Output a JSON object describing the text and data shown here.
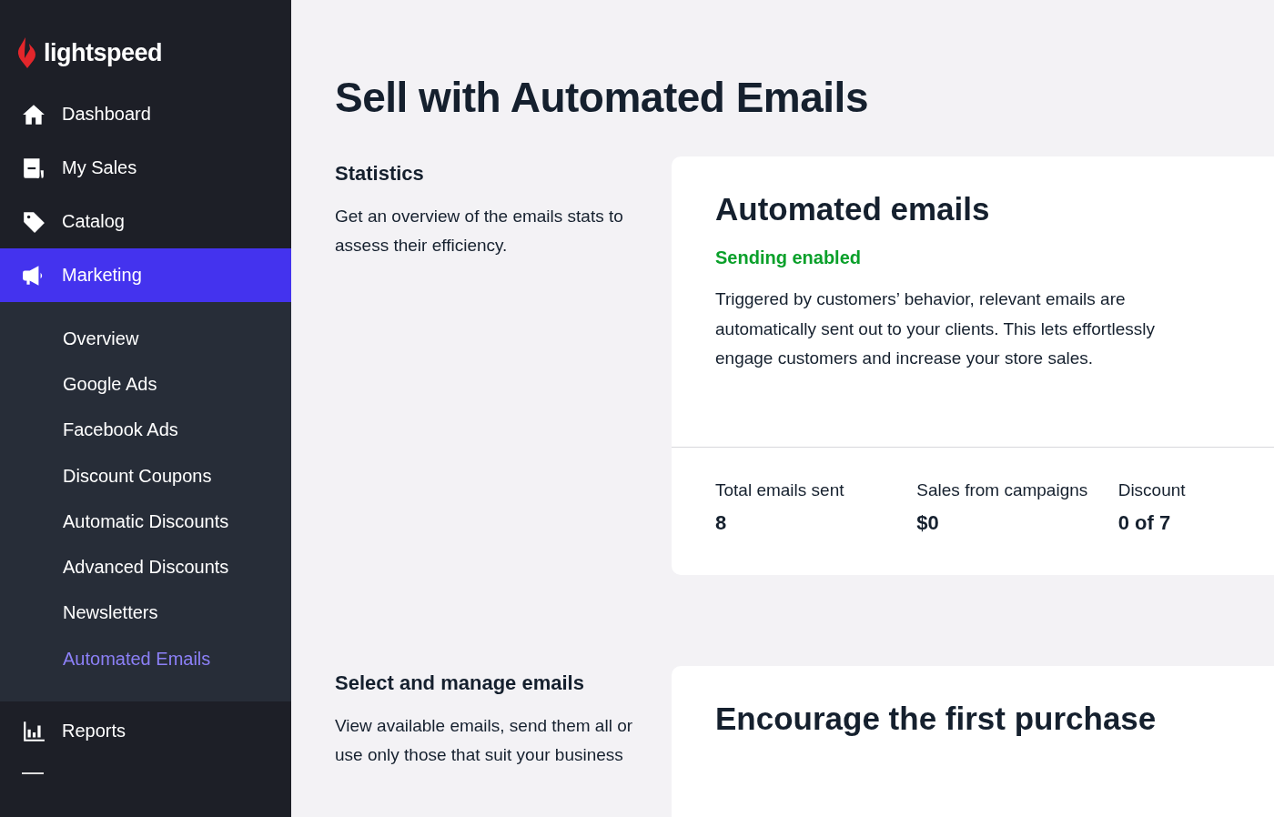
{
  "sidebar": {
    "logo": "lightspeed",
    "items": [
      {
        "label": "Dashboard",
        "selected": false
      },
      {
        "label": "My Sales",
        "selected": false
      },
      {
        "label": "Catalog",
        "selected": false
      },
      {
        "label": "Marketing",
        "selected": true,
        "children": [
          {
            "label": "Overview",
            "selected": false
          },
          {
            "label": "Google Ads",
            "selected": false
          },
          {
            "label": "Facebook Ads",
            "selected": false
          },
          {
            "label": "Discount Coupons",
            "selected": false
          },
          {
            "label": "Automatic Discounts",
            "selected": false
          },
          {
            "label": "Advanced Discounts",
            "selected": false
          },
          {
            "label": "Newsletters",
            "selected": false
          },
          {
            "label": "Automated Emails",
            "selected": true
          }
        ]
      },
      {
        "label": "Reports",
        "selected": false
      }
    ]
  },
  "page": {
    "title": "Sell with Automated Emails",
    "sections": [
      {
        "heading": "Statistics",
        "description": "Get an overview of the emails stats to assess their efficiency.",
        "card": {
          "title": "Automated emails",
          "status": "Sending enabled",
          "body": "Triggered by customers’ behavior, relevant emails are automatically sent out to your clients. This lets effortlessly engage customers and increase your store sales.",
          "stats": [
            {
              "label": "Total emails sent",
              "value": "8"
            },
            {
              "label": "Sales from campaigns",
              "value": "$0"
            },
            {
              "label": "Discount",
              "value": "0 of 7"
            }
          ]
        }
      },
      {
        "heading": "Select and manage emails",
        "description": "View available emails, send them all or use only those that suit your business",
        "card": {
          "title": "Encourage the first purchase"
        }
      }
    ]
  }
}
